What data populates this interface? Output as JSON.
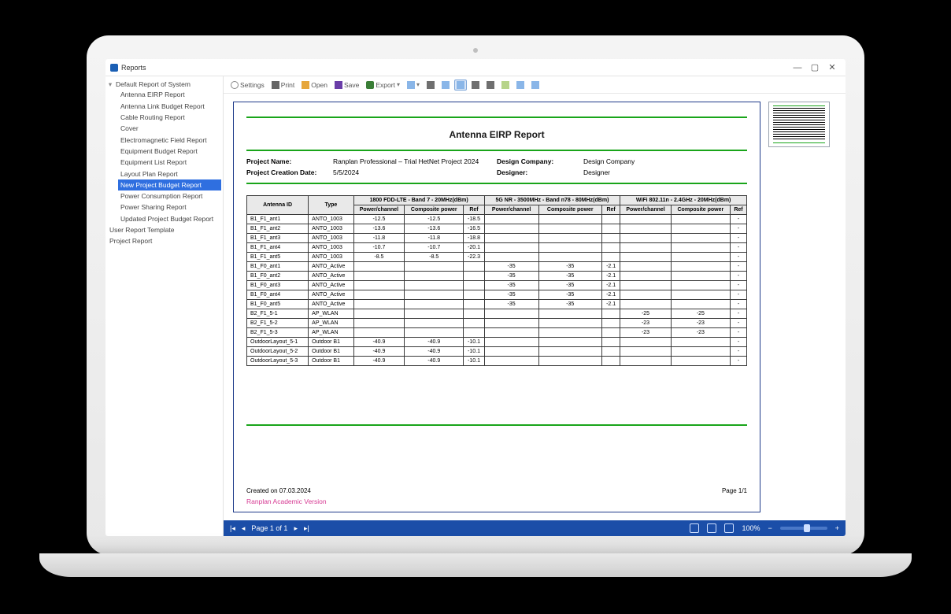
{
  "window": {
    "title": "Reports",
    "minimize": "—",
    "maximize": "▢",
    "close": "✕"
  },
  "tree": {
    "root": "Default Report of System",
    "children": [
      "Antenna EIRP Report",
      "Antenna Link Budget Report",
      "Cable Routing Report",
      "Cover",
      "Electromagnetic Field Report",
      "Equipment Budget Report",
      "Equipment List Report",
      "Layout Plan Report",
      "New Project Budget Report",
      "Power Consumption Report",
      "Power Sharing Report",
      "Updated Project Budget Report"
    ],
    "selected_index": 8,
    "siblings": [
      "User Report Template",
      "Project Report"
    ]
  },
  "toolbar": {
    "settings": "Settings",
    "print": "Print",
    "open": "Open",
    "save": "Save",
    "export": "Export"
  },
  "report": {
    "title": "Antenna EIRP Report",
    "meta": {
      "project_name_label": "Project Name:",
      "project_name": "Ranplan Professional – Trial HetNet Project 2024",
      "design_company_label": "Design Company:",
      "design_company": "Design Company",
      "creation_date_label": "Project Creation Date:",
      "creation_date": "5/5/2024",
      "designer_label": "Designer:",
      "designer": "Designer"
    },
    "columns": {
      "antenna_id": "Antenna ID",
      "type": "Type",
      "group1": "1800 FDD-LTE - Band 7 - 20MHz(dBm)",
      "group2": "5G NR - 3500MHz - Band n78 - 80MHz(dBm)",
      "group3": "WiFi 802.11n - 2.4GHz - 20MHz(dBm)",
      "power_channel": "Power/channel",
      "composite_power": "Composite power",
      "ref": "Ref"
    },
    "rows": [
      {
        "id": "B1_F1_ant1",
        "type": "ANTO_1003",
        "g1": [
          "-12.5",
          "-12.5",
          "-18.5"
        ],
        "g2": [
          "",
          "",
          ""
        ],
        "g3": [
          "",
          "",
          "-"
        ]
      },
      {
        "id": "B1_F1_ant2",
        "type": "ANTO_1003",
        "g1": [
          "-13.6",
          "-13.6",
          "-16.5"
        ],
        "g2": [
          "",
          "",
          ""
        ],
        "g3": [
          "",
          "",
          "-"
        ]
      },
      {
        "id": "B1_F1_ant3",
        "type": "ANTO_1003",
        "g1": [
          "-11.8",
          "-11.8",
          "-18.8"
        ],
        "g2": [
          "",
          "",
          ""
        ],
        "g3": [
          "",
          "",
          "-"
        ]
      },
      {
        "id": "B1_F1_ant4",
        "type": "ANTO_1003",
        "g1": [
          "-10.7",
          "-10.7",
          "-20.1"
        ],
        "g2": [
          "",
          "",
          ""
        ],
        "g3": [
          "",
          "",
          "-"
        ]
      },
      {
        "id": "B1_F1_ant5",
        "type": "ANTO_1003",
        "g1": [
          "-8.5",
          "-8.5",
          "-22.3"
        ],
        "g2": [
          "",
          "",
          ""
        ],
        "g3": [
          "",
          "",
          "-"
        ]
      },
      {
        "id": "B1_F0_ant1",
        "type": "ANTO_Active",
        "g1": [
          "",
          "",
          ""
        ],
        "g2": [
          "-35",
          "-35",
          "-2.1"
        ],
        "g3": [
          "",
          "",
          "-"
        ]
      },
      {
        "id": "B1_F0_ant2",
        "type": "ANTO_Active",
        "g1": [
          "",
          "",
          ""
        ],
        "g2": [
          "-35",
          "-35",
          "-2.1"
        ],
        "g3": [
          "",
          "",
          "-"
        ]
      },
      {
        "id": "B1_F0_ant3",
        "type": "ANTO_Active",
        "g1": [
          "",
          "",
          ""
        ],
        "g2": [
          "-35",
          "-35",
          "-2.1"
        ],
        "g3": [
          "",
          "",
          "-"
        ]
      },
      {
        "id": "B1_F0_ant4",
        "type": "ANTO_Active",
        "g1": [
          "",
          "",
          ""
        ],
        "g2": [
          "-35",
          "-35",
          "-2.1"
        ],
        "g3": [
          "",
          "",
          "-"
        ]
      },
      {
        "id": "B1_F0_ant5",
        "type": "ANTO_Active",
        "g1": [
          "",
          "",
          ""
        ],
        "g2": [
          "-35",
          "-35",
          "-2.1"
        ],
        "g3": [
          "",
          "",
          "-"
        ]
      },
      {
        "id": "B2_F1_5-1",
        "type": "AP_WLAN",
        "g1": [
          "",
          "",
          ""
        ],
        "g2": [
          "",
          "",
          ""
        ],
        "g3": [
          "-25",
          "-25",
          "-"
        ]
      },
      {
        "id": "B2_F1_5-2",
        "type": "AP_WLAN",
        "g1": [
          "",
          "",
          ""
        ],
        "g2": [
          "",
          "",
          ""
        ],
        "g3": [
          "-23",
          "-23",
          "-"
        ]
      },
      {
        "id": "B2_F1_5-3",
        "type": "AP_WLAN",
        "g1": [
          "",
          "",
          ""
        ],
        "g2": [
          "",
          "",
          ""
        ],
        "g3": [
          "-23",
          "-23",
          "-"
        ]
      },
      {
        "id": "OutdoorLayout_5-1",
        "type": "Outdoor B1",
        "g1": [
          "-40.9",
          "-40.9",
          "-10.1"
        ],
        "g2": [
          "",
          "",
          ""
        ],
        "g3": [
          "",
          "",
          "-"
        ]
      },
      {
        "id": "OutdoorLayout_5-2",
        "type": "Outdoor B1",
        "g1": [
          "-40.9",
          "-40.9",
          "-10.1"
        ],
        "g2": [
          "",
          "",
          ""
        ],
        "g3": [
          "",
          "",
          "-"
        ]
      },
      {
        "id": "OutdoorLayout_5-3",
        "type": "Outdoor B1",
        "g1": [
          "-40.9",
          "-40.9",
          "-10.1"
        ],
        "g2": [
          "",
          "",
          ""
        ],
        "g3": [
          "",
          "",
          "-"
        ]
      }
    ],
    "footer_left": "Created on 07.03.2024",
    "footer_right": "Page 1/1",
    "watermark": "Ranplan Academic Version"
  },
  "statusbar": {
    "page_label": "Page 1 of 1",
    "zoom": "100%"
  }
}
